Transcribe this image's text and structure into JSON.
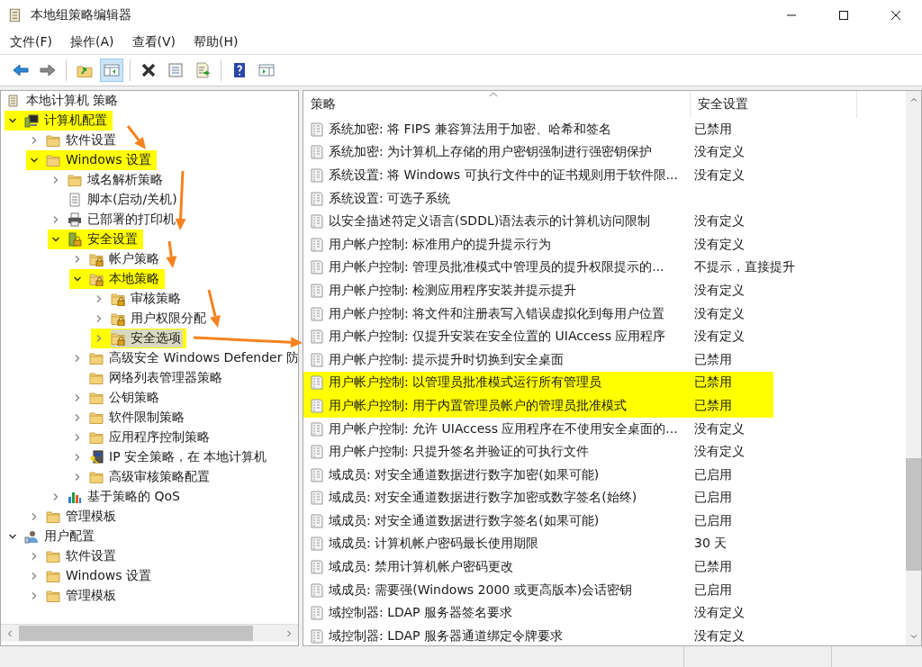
{
  "window": {
    "title": "本地组策略编辑器"
  },
  "menu": [
    {
      "label": "文件(F)"
    },
    {
      "label": "操作(A)"
    },
    {
      "label": "查看(V)"
    },
    {
      "label": "帮助(H)"
    }
  ],
  "toolbar": [
    [
      {
        "kind": "back",
        "pressed": false
      },
      {
        "kind": "forward",
        "pressed": false
      }
    ],
    [
      {
        "kind": "up-folder",
        "pressed": false
      },
      {
        "kind": "tree-toggle",
        "pressed": true
      }
    ],
    [
      {
        "kind": "delete",
        "pressed": false
      },
      {
        "kind": "properties",
        "pressed": false
      },
      {
        "kind": "export",
        "pressed": false
      }
    ],
    [
      {
        "kind": "help",
        "pressed": false
      },
      {
        "kind": "action-pane",
        "pressed": false
      }
    ]
  ],
  "tree": [
    {
      "label": "本地计算机 策略",
      "kind": "policy",
      "highlighted": false,
      "selected": false,
      "children": [
        {
          "label": "计算机配置",
          "kind": "computer",
          "expanded": true,
          "highlighted": true,
          "selected": false,
          "children": [
            {
              "label": "软件设置",
              "kind": "folder",
              "expanded": false,
              "highlighted": false,
              "selected": false
            },
            {
              "label": "Windows 设置",
              "kind": "folder",
              "expanded": true,
              "highlighted": true,
              "selected": false,
              "children": [
                {
                  "label": "域名解析策略",
                  "kind": "folder",
                  "expanded": false,
                  "highlighted": false,
                  "selected": false
                },
                {
                  "label": "脚本(启动/关机)",
                  "kind": "script",
                  "highlighted": false,
                  "selected": false
                },
                {
                  "label": "已部署的打印机",
                  "kind": "printer",
                  "expanded": false,
                  "highlighted": false,
                  "selected": false
                },
                {
                  "label": "安全设置",
                  "kind": "security",
                  "expanded": true,
                  "highlighted": true,
                  "selected": false,
                  "children": [
                    {
                      "label": "帐户策略",
                      "kind": "lock-folder",
                      "expanded": false,
                      "highlighted": false,
                      "selected": false
                    },
                    {
                      "label": "本地策略",
                      "kind": "lock-folder",
                      "expanded": true,
                      "highlighted": true,
                      "selected": false,
                      "children": [
                        {
                          "label": "审核策略",
                          "kind": "lock-folder",
                          "expanded": false,
                          "highlighted": false,
                          "selected": false
                        },
                        {
                          "label": "用户权限分配",
                          "kind": "lock-folder",
                          "expanded": false,
                          "highlighted": false,
                          "selected": false
                        },
                        {
                          "label": "安全选项",
                          "kind": "lock-folder",
                          "expanded": false,
                          "highlighted": true,
                          "selected": true
                        }
                      ]
                    },
                    {
                      "label": "高级安全 Windows Defender 防",
                      "kind": "folder",
                      "expanded": false,
                      "highlighted": false,
                      "selected": false
                    },
                    {
                      "label": "网络列表管理器策略",
                      "kind": "folder",
                      "highlighted": false,
                      "selected": false
                    },
                    {
                      "label": "公钥策略",
                      "kind": "folder",
                      "expanded": false,
                      "highlighted": false,
                      "selected": false
                    },
                    {
                      "label": "软件限制策略",
                      "kind": "folder",
                      "expanded": false,
                      "highlighted": false,
                      "selected": false
                    },
                    {
                      "label": "应用程序控制策略",
                      "kind": "folder",
                      "expanded": false,
                      "highlighted": false,
                      "selected": false
                    },
                    {
                      "label": "IP 安全策略，在 本地计算机",
                      "kind": "ip-security",
                      "expanded": false,
                      "highlighted": false,
                      "selected": false
                    },
                    {
                      "label": "高级审核策略配置",
                      "kind": "folder",
                      "expanded": false,
                      "highlighted": false,
                      "selected": false
                    }
                  ]
                },
                {
                  "label": "基于策略的 QoS",
                  "kind": "qos",
                  "expanded": false,
                  "highlighted": false,
                  "selected": false
                }
              ]
            },
            {
              "label": "管理模板",
              "kind": "folder",
              "expanded": false,
              "highlighted": false,
              "selected": false
            }
          ]
        },
        {
          "label": "用户配置",
          "kind": "user",
          "expanded": true,
          "highlighted": false,
          "selected": false,
          "children": [
            {
              "label": "软件设置",
              "kind": "folder",
              "expanded": false,
              "highlighted": false,
              "selected": false
            },
            {
              "label": "Windows 设置",
              "kind": "folder",
              "expanded": false,
              "highlighted": false,
              "selected": false
            },
            {
              "label": "管理模板",
              "kind": "folder",
              "expanded": false,
              "highlighted": false,
              "selected": false
            }
          ]
        }
      ]
    }
  ],
  "table": {
    "columns": [
      "策略",
      "安全设置"
    ],
    "rows": [
      {
        "policy": "系统加密: 将 FIPS 兼容算法用于加密、哈希和签名",
        "setting": "已禁用",
        "highlighted": false
      },
      {
        "policy": "系统加密: 为计算机上存储的用户密钥强制进行强密钥保护",
        "setting": "没有定义",
        "highlighted": false
      },
      {
        "policy": "系统设置: 将 Windows 可执行文件中的证书规则用于软件限...",
        "setting": "没有定义",
        "highlighted": false
      },
      {
        "policy": "系统设置: 可选子系统",
        "highlighted": false
      },
      {
        "policy": "以安全描述符定义语言(SDDL)语法表示的计算机访问限制",
        "setting": "没有定义",
        "highlighted": false
      },
      {
        "policy": "用户帐户控制: 标准用户的提升提示行为",
        "setting": "没有定义",
        "highlighted": false
      },
      {
        "policy": "用户帐户控制: 管理员批准模式中管理员的提升权限提示的...",
        "setting": "不提示，直接提升",
        "highlighted": false
      },
      {
        "policy": "用户帐户控制: 检测应用程序安装并提示提升",
        "setting": "没有定义",
        "highlighted": false
      },
      {
        "policy": "用户帐户控制: 将文件和注册表写入错误虚拟化到每用户位置",
        "setting": "没有定义",
        "highlighted": false
      },
      {
        "policy": "用户帐户控制: 仅提升安装在安全位置的 UIAccess 应用程序",
        "setting": "没有定义",
        "highlighted": false
      },
      {
        "policy": "用户帐户控制: 提示提升时切换到安全桌面",
        "setting": "已禁用",
        "highlighted": false
      },
      {
        "policy": "用户帐户控制: 以管理员批准模式运行所有管理员",
        "setting": "已禁用",
        "highlighted": true
      },
      {
        "policy": "用户帐户控制: 用于内置管理员帐户的管理员批准模式",
        "setting": "已禁用",
        "highlighted": true
      },
      {
        "policy": "用户帐户控制: 允许 UIAccess 应用程序在不使用安全桌面的...",
        "setting": "没有定义",
        "highlighted": false
      },
      {
        "policy": "用户帐户控制: 只提升签名并验证的可执行文件",
        "setting": "没有定义",
        "highlighted": false
      },
      {
        "policy": "域成员: 对安全通道数据进行数字加密(如果可能)",
        "setting": "已启用",
        "highlighted": false
      },
      {
        "policy": "域成员: 对安全通道数据进行数字加密或数字签名(始终)",
        "setting": "已启用",
        "highlighted": false
      },
      {
        "policy": "域成员: 对安全通道数据进行数字签名(如果可能)",
        "setting": "已启用",
        "highlighted": false
      },
      {
        "policy": "域成员: 计算机帐户密码最长使用期限",
        "setting": "30 天",
        "highlighted": false
      },
      {
        "policy": "域成员: 禁用计算机帐户密码更改",
        "setting": "已禁用",
        "highlighted": false
      },
      {
        "policy": "域成员: 需要强(Windows 2000 或更高版本)会话密钥",
        "setting": "已启用",
        "highlighted": false
      },
      {
        "policy": "域控制器: LDAP 服务器签名要求",
        "setting": "没有定义",
        "highlighted": false
      },
      {
        "policy": "域控制器: LDAP 服务器通道绑定令牌要求",
        "setting": "没有定义",
        "highlighted": false
      }
    ]
  }
}
